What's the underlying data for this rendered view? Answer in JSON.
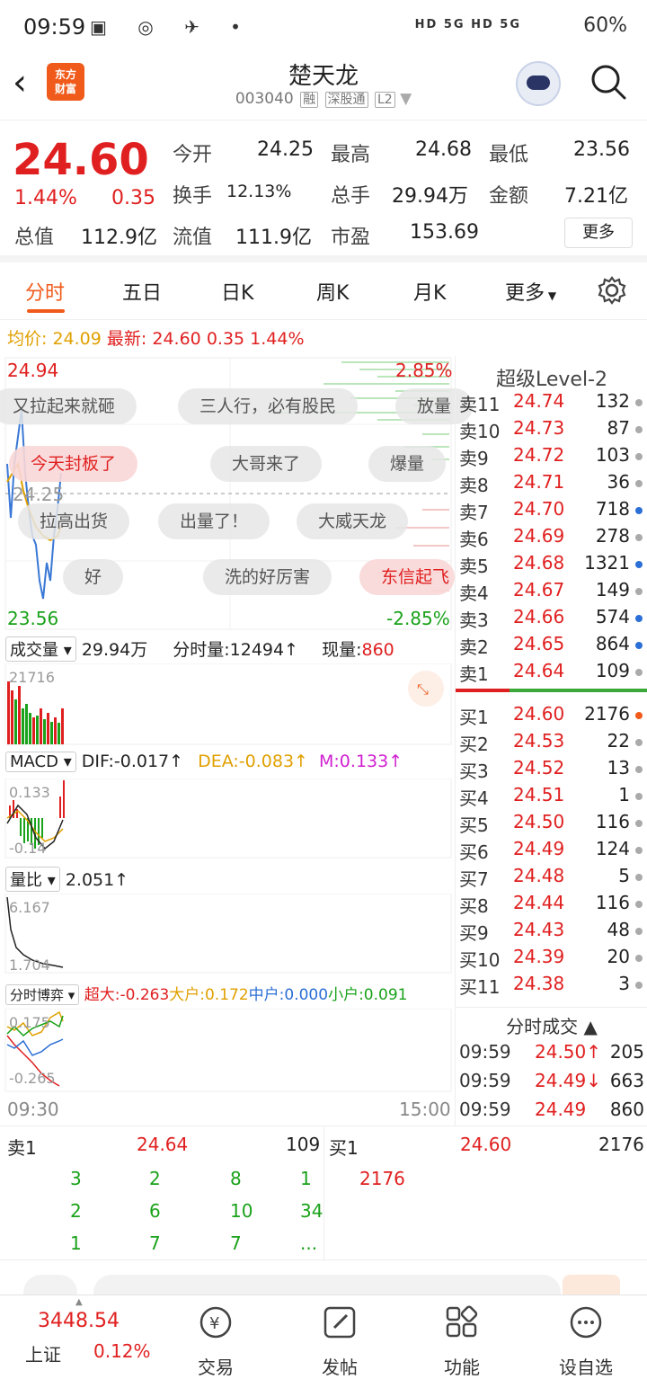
{
  "status": {
    "time": "09:59",
    "battery": "60%",
    "net": "HD 5G HD 5G"
  },
  "header": {
    "logo_line1": "东方",
    "logo_line2": "财富",
    "stock_name": "楚天龙",
    "stock_code": "003040",
    "tag1": "融",
    "tag2": "深股通",
    "tag3": "L2"
  },
  "quote": {
    "price": "24.60",
    "change_pct": "1.44%",
    "change": "0.35",
    "open_label": "今开",
    "open": "24.25",
    "high_label": "最高",
    "high": "24.68",
    "low_label": "最低",
    "low": "23.56",
    "turnover_label": "换手",
    "turnover": "12.13%",
    "volume_label": "总手",
    "volume": "29.94万",
    "amount_label": "金额",
    "amount": "7.21亿",
    "total_cap_label": "总值",
    "total_cap": "112.9亿",
    "float_cap_label": "流值",
    "float_cap": "111.9亿",
    "pe_label": "市盈",
    "pe": "153.69",
    "more": "更多"
  },
  "tabs": [
    "分时",
    "五日",
    "日K",
    "周K",
    "月K",
    "更多"
  ],
  "infoline": {
    "avg_label": "均价:",
    "avg": "24.09",
    "latest_label": "最新:",
    "latest": "24.60",
    "chg": "0.35",
    "pct": "1.44%"
  },
  "chart": {
    "y_high": "24.94",
    "y_low": "23.56",
    "pct_high": "2.85%",
    "pct_low": "-2.85%",
    "open_ref": "24.25",
    "x_start": "09:30",
    "x_end": "15:00",
    "danmu": [
      "又拉起来就砸",
      "三人行，必有股民",
      "放量",
      "今天封板了",
      "大哥来了",
      "爆量",
      "拉高出货",
      "出量了！",
      "大威天龙",
      "好",
      "洗的好厉害",
      "东信起飞"
    ],
    "volume_hdr": {
      "label": "成交量",
      "total": "29.94万",
      "minute": "分时量:12494↑",
      "now_label": "现量:",
      "now": "860",
      "axis": "21716"
    },
    "macd_hdr": {
      "label": "MACD",
      "dif": "DIF:-0.017↑",
      "dea": "DEA:-0.083↑",
      "m": "M:0.133↑",
      "axis_hi": "0.133",
      "axis_lo": "-0.14"
    },
    "lb_hdr": {
      "label": "量比",
      "val": "2.051↑",
      "axis_hi": "6.167",
      "axis_lo": "1.704"
    },
    "game_hdr": {
      "label": "分时博弈",
      "a": "超大:-0.263",
      "b": "大户:0.172",
      "c": "中户:0.000",
      "d": "小户:0.091",
      "axis_hi": "0.175",
      "axis_lo": "-0.265"
    }
  },
  "book": {
    "title": "超级Level-2",
    "asks": [
      {
        "l": "卖11",
        "p": "24.74",
        "v": "132",
        "d": "gray"
      },
      {
        "l": "卖10",
        "p": "24.73",
        "v": "87",
        "d": "gray"
      },
      {
        "l": "卖9",
        "p": "24.72",
        "v": "103",
        "d": "gray"
      },
      {
        "l": "卖8",
        "p": "24.71",
        "v": "36",
        "d": "gray"
      },
      {
        "l": "卖7",
        "p": "24.70",
        "v": "718",
        "d": "blue"
      },
      {
        "l": "卖6",
        "p": "24.69",
        "v": "278",
        "d": "gray"
      },
      {
        "l": "卖5",
        "p": "24.68",
        "v": "1321",
        "d": "blue"
      },
      {
        "l": "卖4",
        "p": "24.67",
        "v": "149",
        "d": "gray"
      },
      {
        "l": "卖3",
        "p": "24.66",
        "v": "574",
        "d": "blue"
      },
      {
        "l": "卖2",
        "p": "24.65",
        "v": "864",
        "d": "blue"
      },
      {
        "l": "卖1",
        "p": "24.64",
        "v": "109",
        "d": "gray"
      }
    ],
    "bids": [
      {
        "l": "买1",
        "p": "24.60",
        "v": "2176",
        "d": "orange"
      },
      {
        "l": "买2",
        "p": "24.53",
        "v": "22",
        "d": "gray"
      },
      {
        "l": "买3",
        "p": "24.52",
        "v": "13",
        "d": "gray"
      },
      {
        "l": "买4",
        "p": "24.51",
        "v": "1",
        "d": "gray"
      },
      {
        "l": "买5",
        "p": "24.50",
        "v": "116",
        "d": "gray"
      },
      {
        "l": "买6",
        "p": "24.49",
        "v": "124",
        "d": "gray"
      },
      {
        "l": "买7",
        "p": "24.48",
        "v": "5",
        "d": "gray"
      },
      {
        "l": "买8",
        "p": "24.44",
        "v": "116",
        "d": "gray"
      },
      {
        "l": "买9",
        "p": "24.43",
        "v": "48",
        "d": "gray"
      },
      {
        "l": "买10",
        "p": "24.39",
        "v": "20",
        "d": "gray"
      },
      {
        "l": "买11",
        "p": "24.38",
        "v": "3",
        "d": "gray"
      }
    ],
    "trades_title": "分时成交",
    "trades": [
      {
        "t": "09:59",
        "p": "24.50↑",
        "v": "205",
        "c": "red"
      },
      {
        "t": "09:59",
        "p": "24.49↓",
        "v": "663",
        "c": "green"
      },
      {
        "t": "09:59",
        "p": "24.49",
        "v": "860",
        "c": "red"
      }
    ]
  },
  "summary": {
    "sell_label": "卖1",
    "sell_price": "24.64",
    "sell_vol": "109",
    "buy_label": "买1",
    "buy_price": "24.60",
    "buy_vol": "2176",
    "sell_queue": [
      [
        "3",
        "2",
        "8",
        "1"
      ],
      [
        "2",
        "6",
        "10",
        "34"
      ],
      [
        "1",
        "7",
        "7",
        "..."
      ]
    ],
    "buy_queue": [
      "2176"
    ]
  },
  "nav": {
    "index_value": "3448.54",
    "index_name": "上证",
    "index_pct": "0.12%",
    "items": [
      "交易",
      "发帖",
      "功能",
      "设自选"
    ]
  }
}
